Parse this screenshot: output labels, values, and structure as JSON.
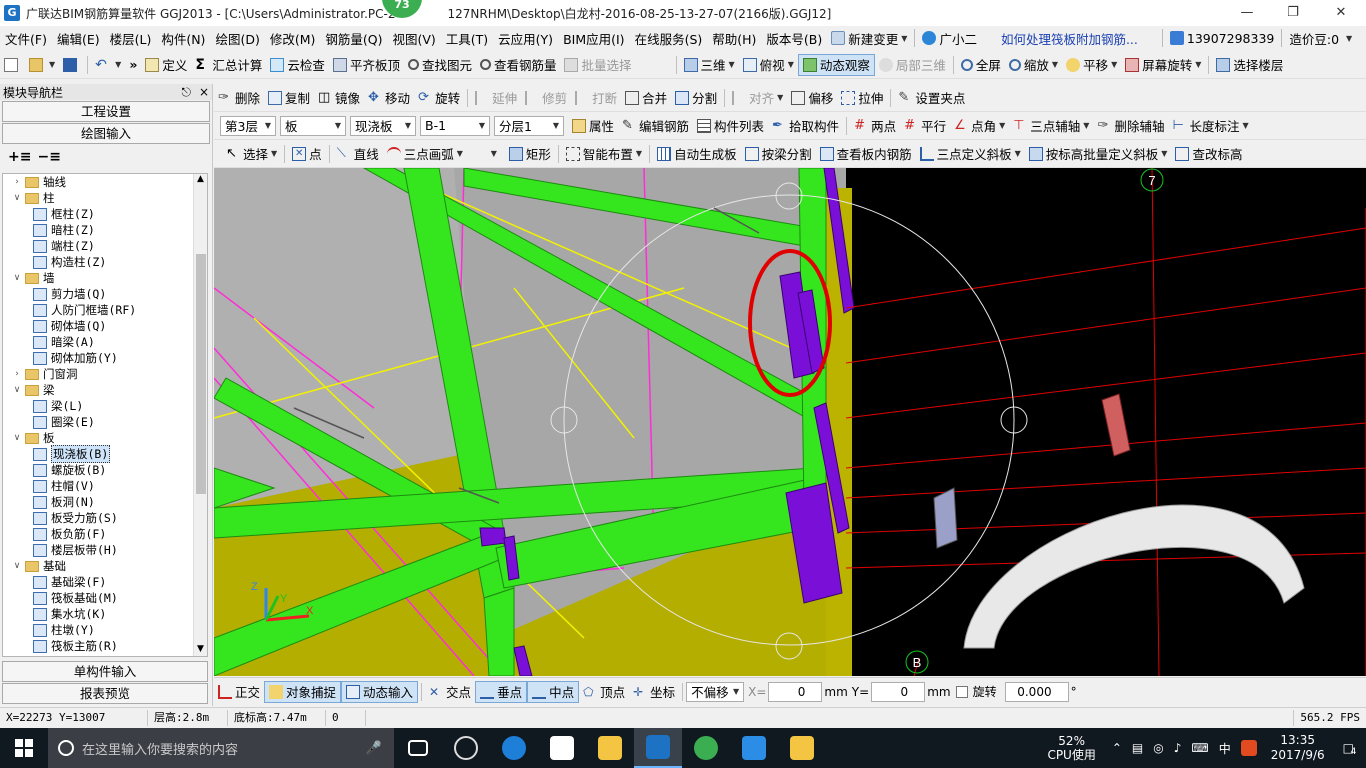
{
  "window": {
    "title": "广联达BIM钢筋算量软件 GGJ2013 - [C:\\Users\\Administrator.PC-20170127NRHM\\Desktop\\白龙村-2016-08-25-13-27-07(2166版).GGJ12]",
    "title_left": "广联达BIM钢筋算量软件 GGJ2013 - [C:\\Users\\Administrator.PC-2",
    "title_right": "127NRHM\\Desktop\\白龙村-2016-08-25-13-27-07(2166版).GGJ12]",
    "badge": "73"
  },
  "menubar": {
    "items": [
      "文件(F)",
      "编辑(E)",
      "楼层(L)",
      "构件(N)",
      "绘图(D)",
      "修改(M)",
      "钢筋量(Q)",
      "视图(V)",
      "工具(T)",
      "云应用(Y)",
      "BIM应用(I)",
      "在线服务(S)",
      "帮助(H)",
      "版本号(B)"
    ],
    "new_change": "新建变更",
    "assistant": "广小二",
    "help_link": "如何处理筏板附加钢筋...",
    "phone": "13907298339",
    "price_bean": "造价豆:0"
  },
  "toolbar1": {
    "define": "定义",
    "sum": "汇总计算",
    "cloud_check": "云检查",
    "flush_slab": "平齐板顶",
    "find_elem": "查找图元",
    "view_rebar": "查看钢筋量",
    "batch_select": "批量选择",
    "three_d": "三维",
    "top_view": "俯视",
    "dynamic_view": "动态观察",
    "local_3d": "局部三维",
    "fullscreen": "全屏",
    "zoom": "缩放",
    "pan": "平移",
    "screen_rotate": "屏幕旋转",
    "select_floor": "选择楼层"
  },
  "toolbar2": {
    "delete": "删除",
    "copy": "复制",
    "mirror": "镜像",
    "move": "移动",
    "rotate": "旋转",
    "extend": "延伸",
    "trim": "修剪",
    "break": "打断",
    "merge": "合并",
    "split": "分割",
    "align": "对齐",
    "offset": "偏移",
    "stretch": "拉伸",
    "set_grip": "设置夹点"
  },
  "toolbar3": {
    "floor": "第3层",
    "type": "板",
    "subtype": "现浇板",
    "element": "B-1",
    "layer": "分层1",
    "property": "属性",
    "edit_rebar": "编辑钢筋",
    "elem_list": "构件列表",
    "pick_elem": "拾取构件",
    "two_points": "两点",
    "parallel": "平行",
    "point_angle": "点角",
    "three_aux": "三点辅轴",
    "delete_aux": "删除辅轴",
    "length_mark": "长度标注"
  },
  "toolbar4": {
    "select": "选择",
    "point": "点",
    "line": "直线",
    "arc": "三点画弧",
    "rect": "矩形",
    "smart_layout": "智能布置",
    "auto_slab": "自动生成板",
    "beam_split": "按梁分割",
    "view_slab_rebar": "查看板内钢筋",
    "slope_3pt": "三点定义斜板",
    "slope_batch": "按标高批量定义斜板",
    "change_elev": "查改标高"
  },
  "left_panel": {
    "header": "模块导航栏",
    "pin": "ꟸ",
    "close": "×",
    "eng_settings": "工程设置",
    "draw_input": "绘图输入",
    "single_input": "单构件输入",
    "report_preview": "报表预览",
    "tree": [
      {
        "type": "folder",
        "open": false,
        "label": "轴线",
        "indent": 0
      },
      {
        "type": "folder",
        "open": true,
        "label": "柱",
        "indent": 0
      },
      {
        "type": "node",
        "label": "框柱(Z)",
        "indent": 1
      },
      {
        "type": "node",
        "label": "暗柱(Z)",
        "indent": 1
      },
      {
        "type": "node",
        "label": "端柱(Z)",
        "indent": 1
      },
      {
        "type": "node",
        "label": "构造柱(Z)",
        "indent": 1
      },
      {
        "type": "folder",
        "open": true,
        "label": "墙",
        "indent": 0
      },
      {
        "type": "node",
        "label": "剪力墙(Q)",
        "indent": 1
      },
      {
        "type": "node",
        "label": "人防门框墙(RF)",
        "indent": 1
      },
      {
        "type": "node",
        "label": "砌体墙(Q)",
        "indent": 1
      },
      {
        "type": "node",
        "label": "暗梁(A)",
        "indent": 1
      },
      {
        "type": "node",
        "label": "砌体加筋(Y)",
        "indent": 1
      },
      {
        "type": "folder",
        "open": false,
        "label": "门窗洞",
        "indent": 0
      },
      {
        "type": "folder",
        "open": true,
        "label": "梁",
        "indent": 0
      },
      {
        "type": "node",
        "label": "梁(L)",
        "indent": 1
      },
      {
        "type": "node",
        "label": "圈梁(E)",
        "indent": 1
      },
      {
        "type": "folder",
        "open": true,
        "label": "板",
        "indent": 0
      },
      {
        "type": "node",
        "label": "现浇板(B)",
        "indent": 1,
        "selected": true
      },
      {
        "type": "node",
        "label": "螺旋板(B)",
        "indent": 1
      },
      {
        "type": "node",
        "label": "柱帽(V)",
        "indent": 1
      },
      {
        "type": "node",
        "label": "板洞(N)",
        "indent": 1
      },
      {
        "type": "node",
        "label": "板受力筋(S)",
        "indent": 1
      },
      {
        "type": "node",
        "label": "板负筋(F)",
        "indent": 1
      },
      {
        "type": "node",
        "label": "楼层板带(H)",
        "indent": 1
      },
      {
        "type": "folder",
        "open": true,
        "label": "基础",
        "indent": 0
      },
      {
        "type": "node",
        "label": "基础梁(F)",
        "indent": 1
      },
      {
        "type": "node",
        "label": "筏板基础(M)",
        "indent": 1
      },
      {
        "type": "node",
        "label": "集水坑(K)",
        "indent": 1
      },
      {
        "type": "node",
        "label": "柱墩(Y)",
        "indent": 1
      },
      {
        "type": "node",
        "label": "筏板主筋(R)",
        "indent": 1
      }
    ]
  },
  "viewport": {
    "axis_label_7": "7",
    "axis_label_b": "B",
    "axis_z": "Z",
    "axis_y": "Y",
    "axis_x": "X"
  },
  "snapbar": {
    "ortho": "正交",
    "obj_snap": "对象捕捉",
    "dyn_input": "动态输入",
    "intersection": "交点",
    "perpendicular": "垂点",
    "midpoint": "中点",
    "vertex": "顶点",
    "coord": "坐标",
    "no_offset": "不偏移",
    "x_label": "X=",
    "x_value": "0",
    "unit1": "mm",
    "y_label": "Y=",
    "y_value": "0",
    "unit2": "mm",
    "rotate_label": "旋转",
    "rotate_value": "0.000",
    "degree": "°"
  },
  "statusbar": {
    "coords": "X=22273 Y=13007",
    "floor_height": "层高:2.8m",
    "base_elev": "底标高:7.47m",
    "value": "0",
    "fps": "565.2 FPS"
  },
  "taskbar": {
    "search_placeholder": "在这里输入你要搜索的内容",
    "cpu_percent": "52%",
    "cpu_label": "CPU使用",
    "ime": "中",
    "time": "13:35",
    "date": "2017/9/6",
    "notifications": "4"
  }
}
